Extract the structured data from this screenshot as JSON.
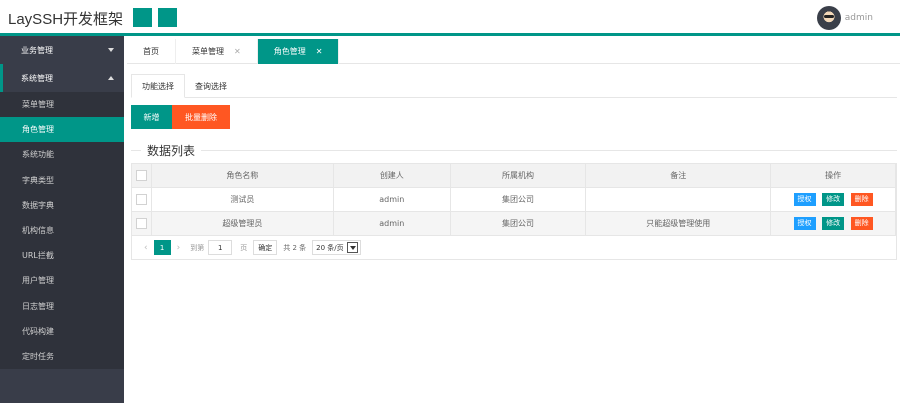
{
  "app": {
    "title": "LaySSH开发框架"
  },
  "header": {
    "username": "admin",
    "avatar_icon": "avatar"
  },
  "colors": {
    "primary": "#009688",
    "danger": "#ff5722",
    "info": "#1e9fff",
    "sidebar": "#393d49"
  },
  "sidebar": {
    "groups": [
      {
        "label": "业务管理",
        "state": "collapsed"
      },
      {
        "label": "系统管理",
        "state": "expanded"
      }
    ],
    "items": [
      {
        "label": "菜单管理"
      },
      {
        "label": "角色管理",
        "active": true
      },
      {
        "label": "系统功能"
      },
      {
        "label": "字典类型"
      },
      {
        "label": "数据字典"
      },
      {
        "label": "机构信息"
      },
      {
        "label": "URL拦截"
      },
      {
        "label": "用户管理"
      },
      {
        "label": "日志管理"
      },
      {
        "label": "代码构建"
      },
      {
        "label": "定时任务"
      }
    ]
  },
  "tabs": [
    {
      "label": "首页",
      "closable": false
    },
    {
      "label": "菜单管理",
      "closable": true
    },
    {
      "label": "角色管理",
      "closable": true,
      "active": true
    }
  ],
  "subtabs": [
    {
      "label": "功能选择",
      "active": true
    },
    {
      "label": "查询选择"
    }
  ],
  "toolbar": {
    "add_label": "新增",
    "batch_delete_label": "批量删除"
  },
  "section": {
    "title": "数据列表"
  },
  "table": {
    "columns": [
      "角色名称",
      "创建人",
      "所属机构",
      "备注",
      "操作"
    ],
    "rows": [
      {
        "name": "测试员",
        "creator": "admin",
        "org": "集团公司",
        "note": ""
      },
      {
        "name": "超级管理员",
        "creator": "admin",
        "org": "集团公司",
        "note": "只能超级管理使用"
      }
    ],
    "actions": {
      "auth": "授权",
      "edit": "修改",
      "delete": "删除"
    }
  },
  "pager": {
    "current_page": "1",
    "goto_prefix": "到第",
    "goto_value": "1",
    "goto_suffix": "页",
    "confirm_label": "确定",
    "total_label": "共 2 条",
    "page_size": "20 条/页"
  }
}
